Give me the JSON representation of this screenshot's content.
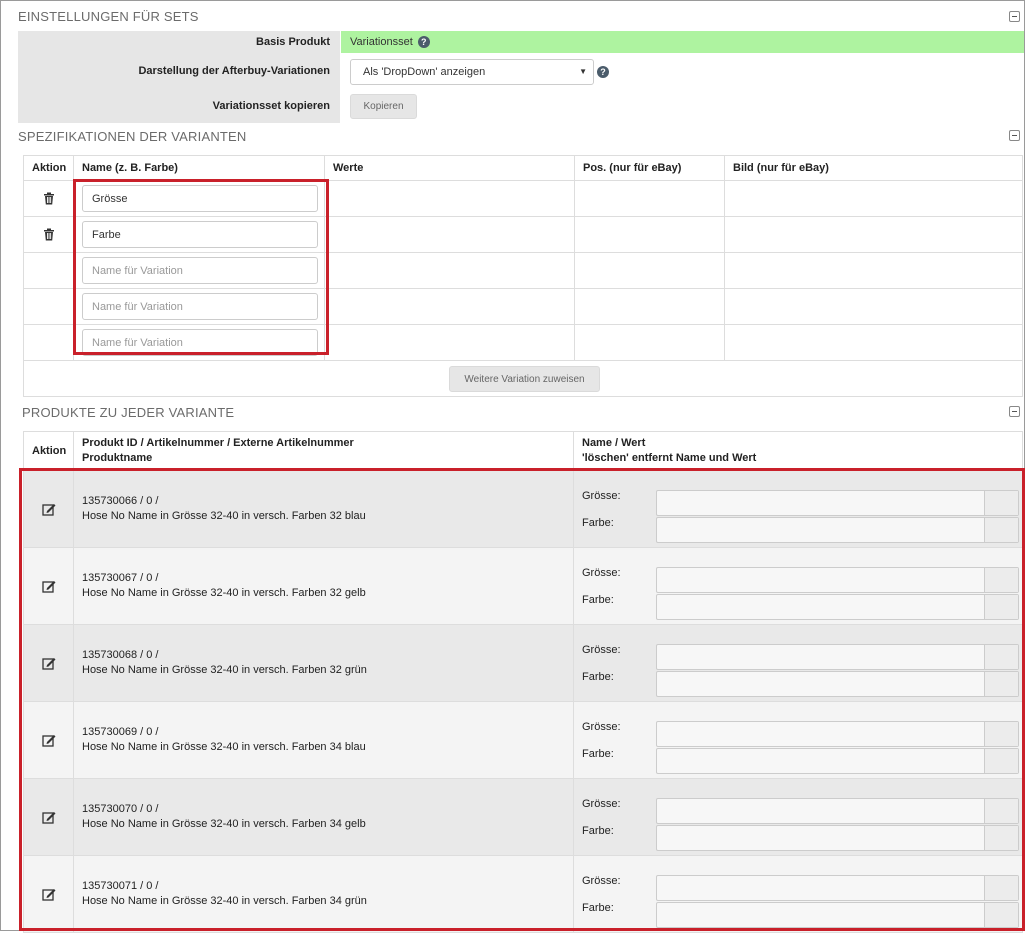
{
  "settings": {
    "section_title": "EINSTELLUNGEN FÜR SETS",
    "basis_label": "Basis Produkt",
    "basis_value": "Variationsset",
    "darstellung_label": "Darstellung der Afterbuy-Variationen",
    "darstellung_value": "Als 'DropDown' anzeigen",
    "kopieren_label": "Variationsset kopieren",
    "kopieren_button": "Kopieren"
  },
  "specs": {
    "section_title": "SPEZIFIKATIONEN DER VARIANTEN",
    "columns": [
      "Aktion",
      "Name (z. B. Farbe)",
      "Werte",
      "Pos. (nur für eBay)",
      "Bild (nur für eBay)"
    ],
    "rows": [
      {
        "value": "Grösse",
        "placeholder": "",
        "has_trash": true
      },
      {
        "value": "Farbe",
        "placeholder": "",
        "has_trash": true
      },
      {
        "value": "",
        "placeholder": "Name für Variation",
        "has_trash": false
      },
      {
        "value": "",
        "placeholder": "Name für Variation",
        "has_trash": false
      },
      {
        "value": "",
        "placeholder": "Name für Variation",
        "has_trash": false
      }
    ],
    "assign_button": "Weitere Variation zuweisen"
  },
  "products": {
    "section_title": "PRODUKTE ZU JEDER VARIANTE",
    "col_action": "Aktion",
    "col_product_line1": "Produkt ID / Artikelnummer / Externe Artikelnummer",
    "col_product_line2": "Produktname",
    "col_nv_line1": "Name / Wert",
    "col_nv_line2": "'löschen' entfernt Name und Wert",
    "label_size": "Grösse:",
    "label_color": "Farbe:",
    "rows": [
      {
        "ids": "135730066 / 0 /",
        "name": "Hose No Name in Grösse 32-40 in versch. Farben 32 blau"
      },
      {
        "ids": "135730067 / 0 /",
        "name": "Hose No Name in Grösse 32-40 in versch. Farben 32 gelb"
      },
      {
        "ids": "135730068 / 0 /",
        "name": "Hose No Name in Grösse 32-40 in versch. Farben 32 grün"
      },
      {
        "ids": "135730069 / 0 /",
        "name": "Hose No Name in Grösse 32-40 in versch. Farben 34 blau"
      },
      {
        "ids": "135730070 / 0 /",
        "name": "Hose No Name in Grösse 32-40 in versch. Farben 34 gelb"
      },
      {
        "ids": "135730071 / 0 /",
        "name": "Hose No Name in Grösse 32-40 in versch. Farben 34 grün"
      }
    ]
  },
  "colors": {
    "basis_bg": "#aef3a0",
    "highlight_frame": "#c9202a"
  }
}
